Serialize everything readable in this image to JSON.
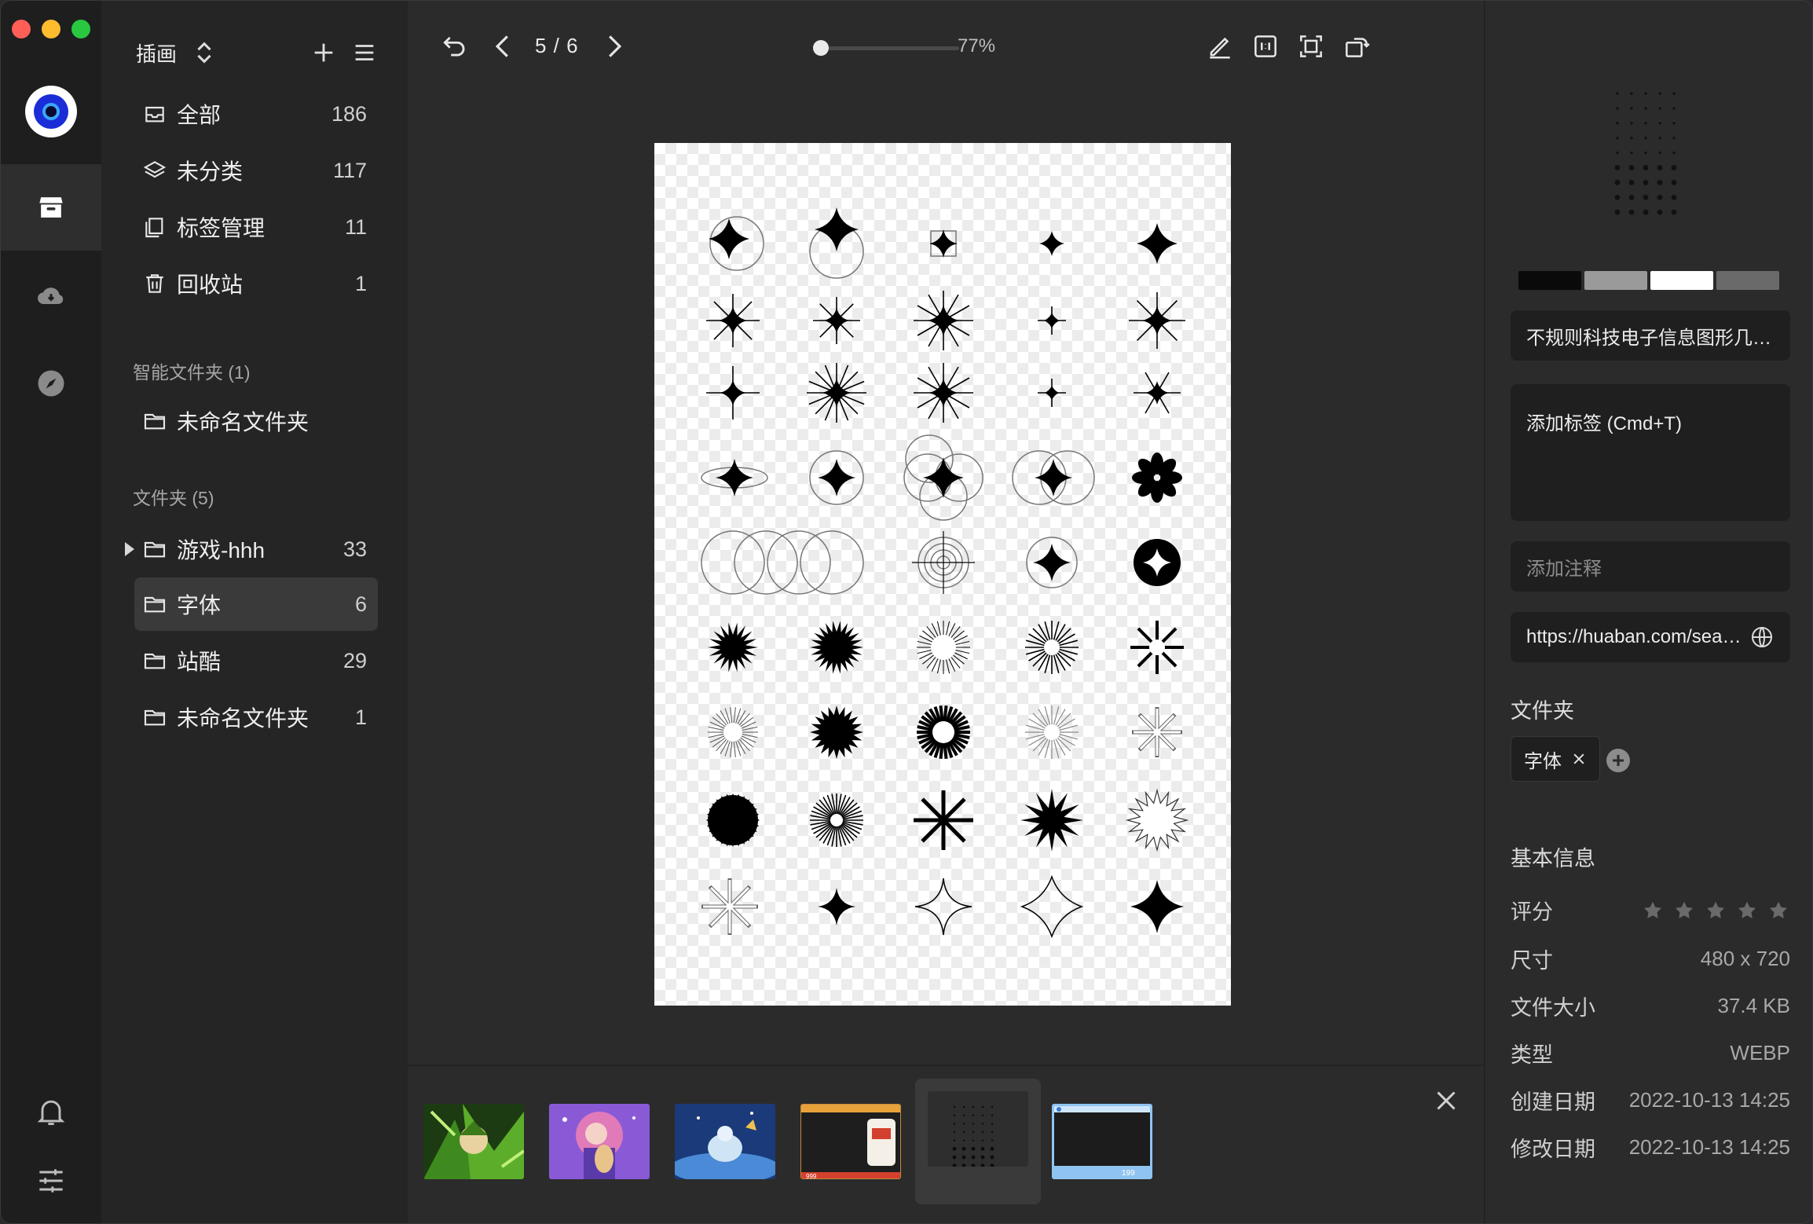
{
  "library": {
    "title": "插画",
    "add_label": "+",
    "menu_label": "≡"
  },
  "nav": [
    {
      "label": "全部",
      "count": "186",
      "icon": "inbox-icon"
    },
    {
      "label": "未分类",
      "count": "117",
      "icon": "layers-icon"
    },
    {
      "label": "标签管理",
      "count": "11",
      "icon": "tag-icon"
    },
    {
      "label": "回收站",
      "count": "1",
      "icon": "trash-icon"
    }
  ],
  "smart_section": {
    "title": "智能文件夹 (1)",
    "items": [
      {
        "label": "未命名文件夹"
      }
    ]
  },
  "folder_section": {
    "title": "文件夹 (5)",
    "items": [
      {
        "label": "游戏-hhh",
        "count": "33"
      },
      {
        "label": "字体",
        "count": "6"
      },
      {
        "label": "站酷",
        "count": "29"
      },
      {
        "label": "未命名文件夹",
        "count": "1"
      }
    ]
  },
  "viewer": {
    "pager": "5 / 6",
    "zoom": "77%",
    "zoom_fraction": 0.0
  },
  "details": {
    "title_value": "不规则科技电子信息图形几何装饰元素",
    "tags_placeholder": "添加标签 (Cmd+T)",
    "note_placeholder": "添加注释",
    "url": "https://huaban.com/search?q=sparkle",
    "folder_heading": "文件夹",
    "folder_chip": "字体",
    "basic_heading": "基本信息",
    "rating_label": "评分",
    "rating_value": 0,
    "size_label": "尺寸",
    "size_value": "480 x 720",
    "filesize_label": "文件大小",
    "filesize_value": "37.4 KB",
    "type_label": "类型",
    "type_value": "WEBP",
    "created_label": "创建日期",
    "created_value": "2022-10-13 14:25",
    "modified_label": "修改日期",
    "modified_value": "2022-10-13 14:25",
    "swatch_colors": [
      "#0a0a0a",
      "#9a9a9a",
      "#ffffff",
      "#6a6a6a"
    ]
  }
}
